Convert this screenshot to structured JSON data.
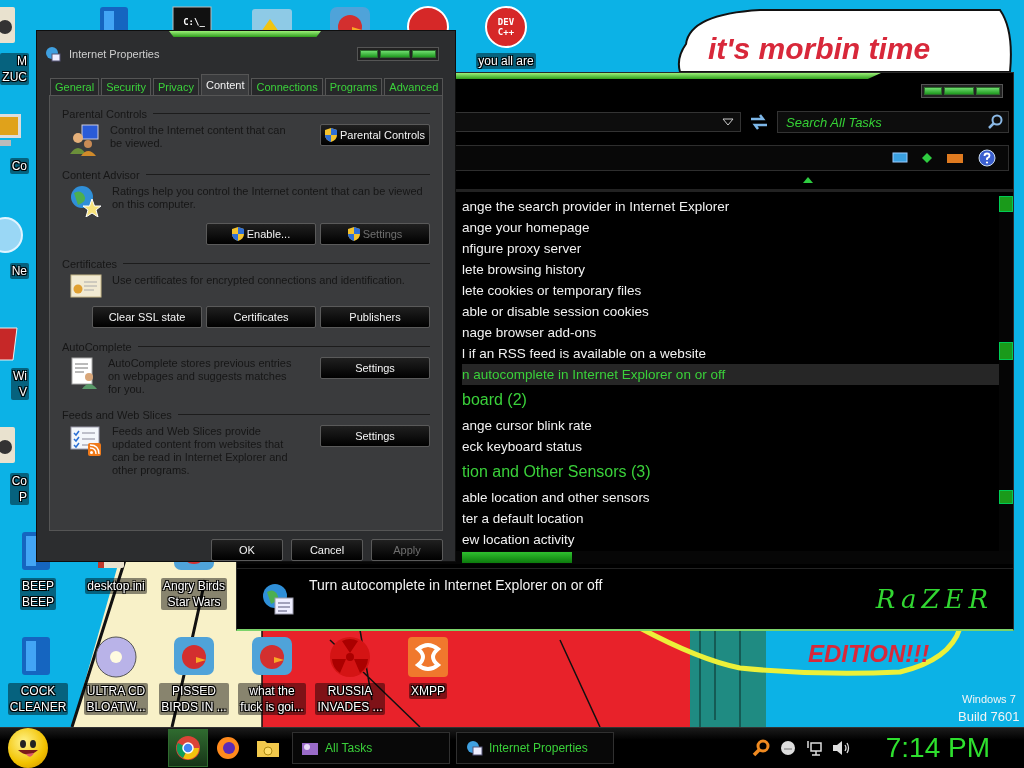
{
  "wallpaper": {
    "sign_text": "it's morbin time",
    "caption": "EDITION!!!",
    "os_name": "Windows 7",
    "build": "Build 7601"
  },
  "desktop_icons": [
    {
      "kind": "book",
      "lines": [
        "M",
        "ZUC"
      ]
    },
    {
      "kind": "tile"
    },
    {
      "kind": "terminal",
      "glyph": "C:\\_"
    },
    {
      "kind": "picture"
    },
    {
      "kind": "bird"
    },
    {
      "kind": "orb"
    },
    {
      "kind": "orb",
      "glyph": "DEV C++",
      "lines": [
        "you all are"
      ]
    },
    {
      "kind": "monitor",
      "lines": [
        "Co"
      ]
    },
    {
      "kind": "globe",
      "lines": [
        "Ne"
      ]
    },
    {
      "kind": "bin",
      "lines": [
        "Wi",
        "V"
      ]
    },
    {
      "kind": "book",
      "lines": [
        "Co",
        "P"
      ]
    },
    {
      "kind": "tile",
      "lines": [
        "BEEP",
        "BEEP"
      ]
    },
    {
      "kind": "book",
      "lines": [
        "desktop.ini"
      ]
    },
    {
      "kind": "bird",
      "lines": [
        "Angry Birds",
        "Star Wars"
      ]
    },
    {
      "kind": "tile",
      "lines": [
        "COCK",
        "CLEANER"
      ]
    },
    {
      "kind": "disc",
      "lines": [
        "ULTRA CD",
        "BLOATW..."
      ]
    },
    {
      "kind": "bird",
      "lines": [
        "PISSED",
        "BIRDS IN ..."
      ]
    },
    {
      "kind": "bird",
      "lines": [
        "what the",
        "fuck is goi..."
      ]
    },
    {
      "kind": "radiation",
      "lines": [
        "RUSSIA",
        "INVADES ..."
      ]
    },
    {
      "kind": "logo",
      "lines": [
        "XMPP"
      ]
    }
  ],
  "task_window": {
    "search": {
      "placeholder": "Search All Tasks"
    },
    "tasks": [
      {
        "kind": "item",
        "text": "ange the search provider in Internet Explorer",
        "selected": false
      },
      {
        "kind": "item",
        "text": "ange your homepage",
        "selected": false
      },
      {
        "kind": "item",
        "text": "nfigure proxy server",
        "selected": false
      },
      {
        "kind": "item",
        "text": "lete browsing history",
        "selected": false
      },
      {
        "kind": "item",
        "text": "lete cookies or temporary files",
        "selected": false
      },
      {
        "kind": "item",
        "text": "able or disable session cookies",
        "selected": false
      },
      {
        "kind": "item",
        "text": "nage browser add-ons",
        "selected": false
      },
      {
        "kind": "item",
        "text": "l if an RSS feed is available on a website",
        "selected": false
      },
      {
        "kind": "item",
        "text": "n autocomplete in Internet Explorer on or off",
        "selected": true
      },
      {
        "kind": "category",
        "text": "board (2)"
      },
      {
        "kind": "item",
        "text": "ange cursor blink rate",
        "selected": false
      },
      {
        "kind": "item",
        "text": "eck keyboard status",
        "selected": false
      },
      {
        "kind": "category",
        "text": "tion and Other Sensors (3)"
      },
      {
        "kind": "item",
        "text": "able location and other sensors",
        "selected": false
      },
      {
        "kind": "item",
        "text": "ter a default location",
        "selected": false
      },
      {
        "kind": "item",
        "text": "ew location activity",
        "selected": false
      }
    ],
    "details": {
      "text": "Turn autocomplete in Internet Explorer on or off"
    },
    "logo": "RaZER"
  },
  "dialog": {
    "title": "Internet Properties",
    "tabs": [
      {
        "label": "General",
        "selected": false
      },
      {
        "label": "Security",
        "selected": false
      },
      {
        "label": "Privacy",
        "selected": false
      },
      {
        "label": "Content",
        "selected": true
      },
      {
        "label": "Connections",
        "selected": false
      },
      {
        "label": "Programs",
        "selected": false
      },
      {
        "label": "Advanced",
        "selected": false
      }
    ],
    "sections": [
      {
        "kind": "side",
        "title": "Parental Controls",
        "description": "Control the Internet content that can be viewed.",
        "buttons": [
          {
            "label": "Parental Controls",
            "shield": true,
            "disabled": false
          }
        ]
      },
      {
        "kind": "below",
        "title": "Content Advisor",
        "description": "Ratings help you control the Internet content that can be viewed on this computer.",
        "buttons": [
          {
            "label": "Enable...",
            "shield": true,
            "disabled": false
          },
          {
            "label": "Settings",
            "shield": true,
            "disabled": true
          }
        ]
      },
      {
        "kind": "below",
        "title": "Certificates",
        "description": "Use certificates for encrypted connections and identification.",
        "buttons": [
          {
            "label": "Clear SSL state",
            "shield": false,
            "disabled": false
          },
          {
            "label": "Certificates",
            "shield": false,
            "disabled": false
          },
          {
            "label": "Publishers",
            "shield": false,
            "disabled": false
          }
        ]
      },
      {
        "kind": "side",
        "title": "AutoComplete",
        "description": "AutoComplete stores previous entries on webpages and suggests matches for you.",
        "buttons": [
          {
            "label": "Settings",
            "shield": false,
            "disabled": false
          }
        ]
      },
      {
        "kind": "side",
        "title": "Feeds and Web Slices",
        "description": "Feeds and Web Slices provide updated content from websites that can be read in Internet Explorer and other programs.",
        "buttons": [
          {
            "label": "Settings",
            "shield": false,
            "disabled": false
          }
        ]
      }
    ],
    "footer_buttons": [
      {
        "label": "OK",
        "disabled": false
      },
      {
        "label": "Cancel",
        "disabled": false
      },
      {
        "label": "Apply",
        "disabled": true
      }
    ]
  },
  "taskbar": {
    "pinned": [
      {
        "selected": true
      },
      {
        "selected": false
      },
      {
        "selected": false
      }
    ],
    "tasks": [
      {
        "label": "All Tasks"
      },
      {
        "label": "Internet Properties"
      }
    ],
    "clock": "7:14 PM"
  }
}
